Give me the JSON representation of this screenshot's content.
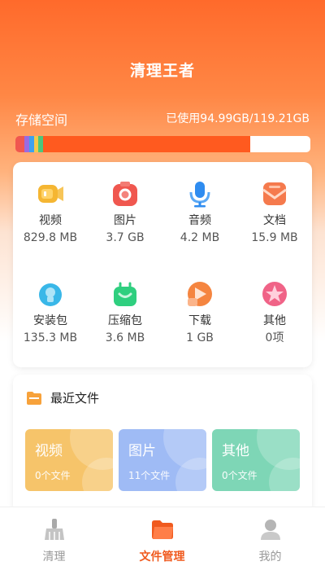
{
  "app": {
    "title": "清理王者"
  },
  "storage": {
    "label": "存储空间",
    "used_text": "已使用94.99GB/119.21GB",
    "used_fraction": 0.797
  },
  "categories": [
    {
      "name": "视频",
      "size": "829.8 MB",
      "icon": "video-icon",
      "color": "#f5b632"
    },
    {
      "name": "图片",
      "size": "3.7 GB",
      "icon": "camera-icon",
      "color": "#f0574f"
    },
    {
      "name": "音频",
      "size": "4.2 MB",
      "icon": "microphone-icon",
      "color": "#2f8cf0"
    },
    {
      "name": "文档",
      "size": "15.9 MB",
      "icon": "document-icon",
      "color": "#f57a4d"
    },
    {
      "name": "安装包",
      "size": "135.3 MB",
      "icon": "install-package-icon",
      "color": "#39b7e8"
    },
    {
      "name": "压缩包",
      "size": "3.6 MB",
      "icon": "archive-bag-icon",
      "color": "#2fcf7f"
    },
    {
      "name": "下载",
      "size": "1 GB",
      "icon": "download-icon",
      "color": "#f58540"
    },
    {
      "name": "其他",
      "size": "0项",
      "icon": "star-icon",
      "color": "#f06387"
    }
  ],
  "recent": {
    "title": "最近文件",
    "icon": "folder-icon",
    "tiles": [
      {
        "name": "视频",
        "count": "0个文件",
        "color": "#f6c46a"
      },
      {
        "name": "图片",
        "count": "11个文件",
        "color": "#9fbbf5"
      },
      {
        "name": "其他",
        "count": "0个文件",
        "color": "#7ed6b6"
      }
    ]
  },
  "tabs": [
    {
      "label": "清理",
      "icon": "broom-icon",
      "active": false
    },
    {
      "label": "文件管理",
      "icon": "folder-icon",
      "active": true
    },
    {
      "label": "我的",
      "icon": "user-icon",
      "active": false
    }
  ]
}
